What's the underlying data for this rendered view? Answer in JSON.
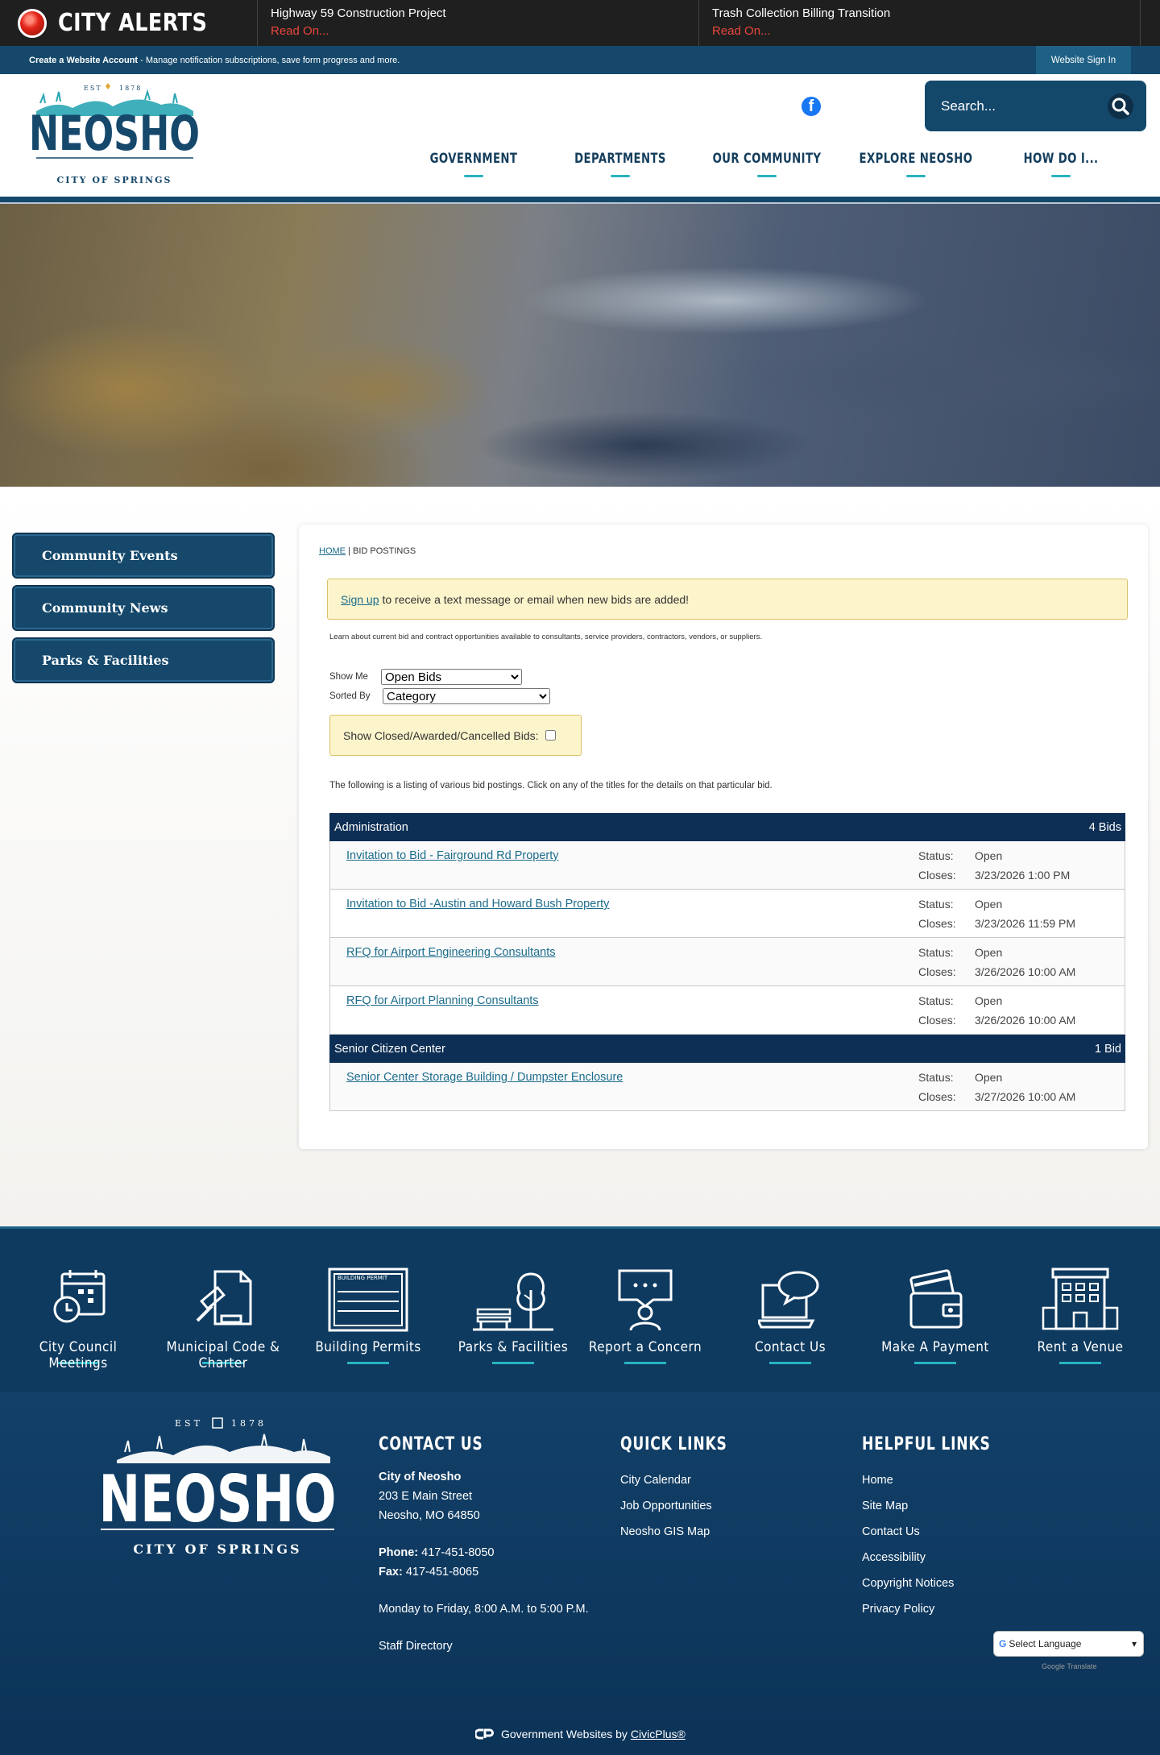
{
  "alerts": {
    "title": "CITY ALERTS",
    "items": [
      {
        "title": "Highway 59 Construction Project",
        "link": "Read On..."
      },
      {
        "title": "Trash Collection Billing Transition",
        "link": "Read On..."
      }
    ]
  },
  "account": {
    "create_label": "Create a Website Account",
    "create_desc": "- Manage notification subscriptions, save form progress and more.",
    "signin_label": "Website Sign In"
  },
  "header": {
    "logo": {
      "est": "EST",
      "year": "1878",
      "name": "NEOSHO",
      "tagline": "CITY OF SPRINGS"
    },
    "search_placeholder": "Search...",
    "nav": [
      "GOVERNMENT",
      "DEPARTMENTS",
      "OUR COMMUNITY",
      "EXPLORE NEOSHO",
      "HOW DO I..."
    ]
  },
  "sidebar": {
    "items": [
      "Community Events",
      "Community News",
      "Parks & Facilities"
    ]
  },
  "content": {
    "breadcrumb_home": "HOME",
    "breadcrumb_sep": " | ",
    "breadcrumb_current": "BID POSTINGS",
    "signup_link": "Sign up",
    "signup_text": "to receive a text message or email when new bids are added!",
    "intro": "Learn about current bid and contract opportunities available to consultants, service providers, contractors, vendors, or suppliers.",
    "show_me_label": "Show Me",
    "show_me_value": "Open Bids",
    "sorted_by_label": "Sorted By",
    "sorted_by_value": "Category",
    "closed_label": "Show Closed/Awarded/Cancelled Bids:",
    "listing_text": "The following is a listing of various bid postings. Click on any of the titles for the details on that particular bid.",
    "status_label": "Status:",
    "closes_label": "Closes:",
    "categories": [
      {
        "name": "Administration",
        "count": "4 Bids",
        "bids": [
          {
            "title": "Invitation to Bid - Fairground Rd Property",
            "status": "Open",
            "closes": "3/23/2026 1:00 PM"
          },
          {
            "title": "Invitation to Bid -Austin and Howard Bush Property",
            "status": "Open",
            "closes": "3/23/2026 11:59 PM"
          },
          {
            "title": "RFQ for Airport Engineering Consultants",
            "status": "Open",
            "closes": "3/26/2026 10:00 AM"
          },
          {
            "title": "RFQ for Airport Planning Consultants",
            "status": "Open",
            "closes": "3/26/2026 10:00 AM"
          }
        ]
      },
      {
        "name": "Senior Citizen Center",
        "count": "1 Bid",
        "bids": [
          {
            "title": "Senior Center Storage Building / Dumpster Enclosure",
            "status": "Open",
            "closes": "3/27/2026 10:00 AM"
          }
        ]
      }
    ]
  },
  "quick_links": [
    {
      "label": "City Council Meetings",
      "icon": "calendar-clock-icon"
    },
    {
      "label": "Municipal Code & Charter",
      "icon": "gavel-document-icon"
    },
    {
      "label": "Building Permits",
      "icon": "building-permit-icon",
      "icon_text": "BUILDING PERMIT"
    },
    {
      "label": "Parks & Facilities",
      "icon": "park-bench-tree-icon"
    },
    {
      "label": "Report a Concern",
      "icon": "person-speech-icon"
    },
    {
      "label": "Contact Us",
      "icon": "laptop-chat-icon"
    },
    {
      "label": "Make A Payment",
      "icon": "wallet-card-icon"
    },
    {
      "label": "Rent a Venue",
      "icon": "building-icon"
    }
  ],
  "footer": {
    "logo": {
      "est": "EST",
      "year": "1878",
      "name": "NEOSHO",
      "tagline": "CITY OF SPRINGS"
    },
    "contact": {
      "heading": "CONTACT US",
      "org": "City of Neosho",
      "street": "203 E Main Street",
      "city": "Neosho, MO 64850",
      "phone_label": "Phone:",
      "phone": "417-451-8050",
      "fax_label": "Fax:",
      "fax": "417-451-8065",
      "hours": "Monday to Friday, 8:00 A.M. to 5:00 P.M.",
      "staff": "Staff Directory"
    },
    "quick": {
      "heading": "QUICK LINKS",
      "links": [
        "City Calendar",
        "Job Opportunities",
        "Neosho GIS Map"
      ]
    },
    "helpful": {
      "heading": "HELPFUL LINKS",
      "links": [
        "Home",
        "Site Map",
        "Contact Us",
        "Accessibility",
        "Copyright Notices",
        "Privacy Policy"
      ]
    },
    "translate": {
      "label": "Select Language",
      "powered": "Google Translate"
    },
    "civic_text": "Government Websites by",
    "civic_link": "CivicPlus®"
  },
  "colors": {
    "navy": "#15486b",
    "dark_navy": "#0e2f55",
    "accent": "#28b3c1",
    "alert_red": "#e9463c",
    "notice_bg": "#fcf4cb"
  }
}
